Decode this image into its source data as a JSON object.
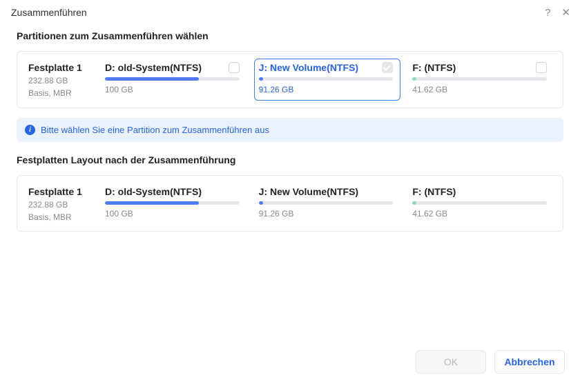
{
  "title": "Zusammenführen",
  "section1_heading": "Partitionen zum Zusammenführen wählen",
  "section2_heading": "Festplatten Layout nach der Zusammenführung",
  "info_message": "Bitte wählen Sie eine Partition zum Zusammenführen aus",
  "disk": {
    "name": "Festplatte 1",
    "size": "232.88 GB",
    "scheme": "Basis, MBR"
  },
  "partitions": [
    {
      "name": "D: old-System(NTFS)",
      "size": "100 GB",
      "color": "blue",
      "fill": 70,
      "checked": false,
      "selected": false
    },
    {
      "name": "J: New Volume(NTFS)",
      "size": "91.26 GB",
      "color": "blue",
      "fill": 3,
      "checked": true,
      "selected": true
    },
    {
      "name": "F: (NTFS)",
      "size": "41.62 GB",
      "color": "teal",
      "fill": 3,
      "checked": false,
      "selected": false
    }
  ],
  "result_partitions": [
    {
      "name": "D: old-System(NTFS)",
      "size": "100 GB",
      "color": "blue",
      "fill": 70
    },
    {
      "name": "J: New Volume(NTFS)",
      "size": "91.26 GB",
      "color": "blue",
      "fill": 3
    },
    {
      "name": "F: (NTFS)",
      "size": "41.62 GB",
      "color": "teal",
      "fill": 3
    }
  ],
  "buttons": {
    "ok": "OK",
    "cancel": "Abbrechen"
  }
}
